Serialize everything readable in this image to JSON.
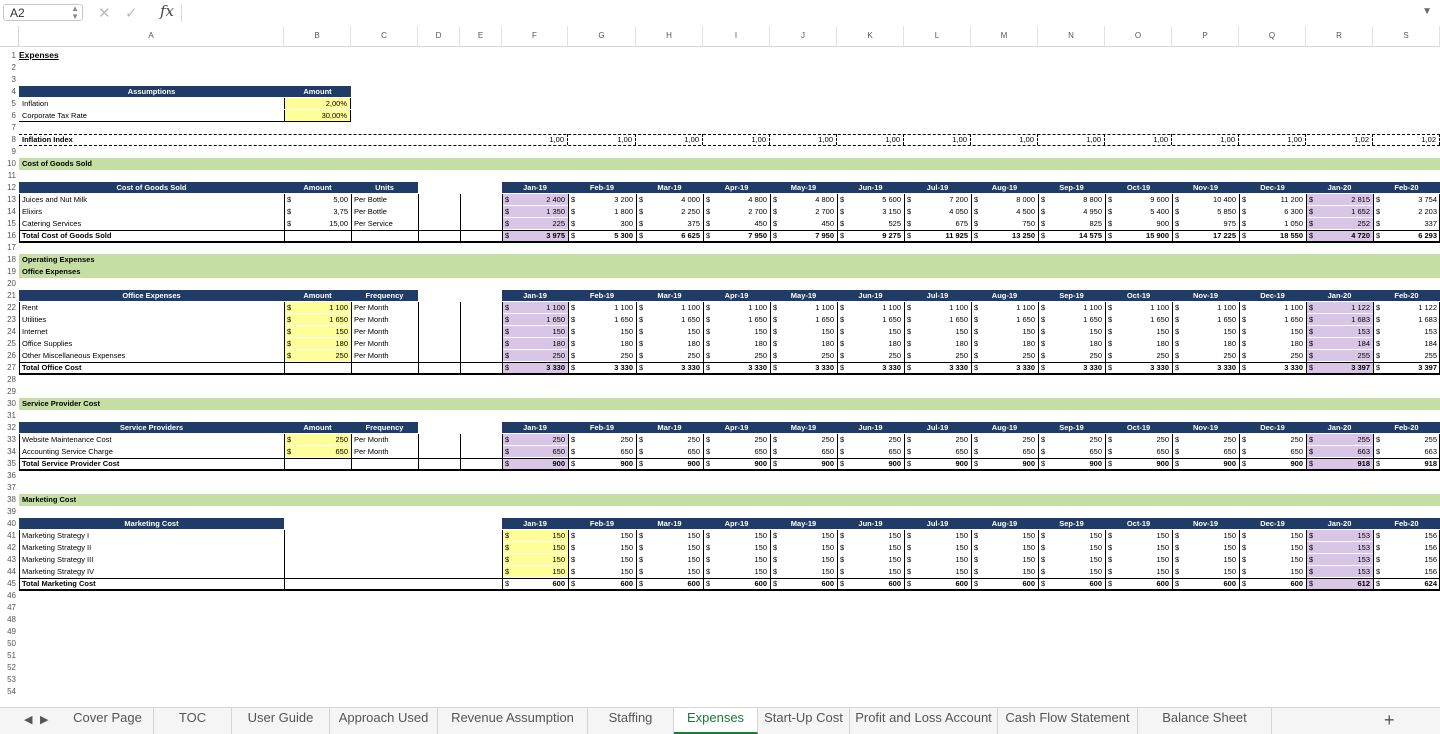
{
  "formula_bar": {
    "name_box": "A2",
    "fx": "fx",
    "cancel": "✕",
    "accept": "✓"
  },
  "columns": [
    "A",
    "B",
    "C",
    "D",
    "E",
    "F",
    "G",
    "H",
    "I",
    "J",
    "K",
    "L",
    "M",
    "N",
    "O",
    "P",
    "Q",
    "R",
    "S"
  ],
  "months": [
    "Jan-19",
    "Feb-19",
    "Mar-19",
    "Apr-19",
    "May-19",
    "Jun-19",
    "Jul-19",
    "Aug-19",
    "Sep-19",
    "Oct-19",
    "Nov-19",
    "Dec-19",
    "Jan-20",
    "Feb-20"
  ],
  "title": "Expenses",
  "assumptions": {
    "header": "Assumptions",
    "amount_header": "Amount",
    "rows": [
      {
        "label": "Inflation",
        "value": "2,00%"
      },
      {
        "label": "Corporate Tax Rate",
        "value": "30,00%"
      }
    ]
  },
  "inflation_index": {
    "label": "Inflation Index",
    "values": [
      "1,00",
      "1,00",
      "1,00",
      "1,00",
      "1,00",
      "1,00",
      "1,00",
      "1,00",
      "1,00",
      "1,00",
      "1,00",
      "1,00",
      "1,02",
      "1,02"
    ]
  },
  "sections": {
    "cogs_title": "Cost of Goods Sold",
    "opex_title": "Operating Expenses",
    "office_title": "Office Expenses",
    "service_title": "Service Provider Cost",
    "marketing_title": "Marketing Cost"
  },
  "currency": "$",
  "cogs": {
    "header": "Cost of Goods Sold",
    "amount_header": "Amount",
    "units_header": "Units",
    "rows": [
      {
        "label": "Juices and Nut Milk",
        "amount": "5,00",
        "unit": "Per Bottle",
        "values": [
          "2 400",
          "3 200",
          "4 000",
          "4 800",
          "4 800",
          "5 600",
          "7 200",
          "8 000",
          "8 800",
          "9 600",
          "10 400",
          "11 200",
          "2 815",
          "3 754"
        ]
      },
      {
        "label": "Elixirs",
        "amount": "3,75",
        "unit": "Per Bottle",
        "values": [
          "1 350",
          "1 800",
          "2 250",
          "2 700",
          "2 700",
          "3 150",
          "4 050",
          "4 500",
          "4 950",
          "5 400",
          "5 850",
          "6 300",
          "1 652",
          "2 203"
        ]
      },
      {
        "label": "Catering Services",
        "amount": "15,00",
        "unit": "Per Service",
        "values": [
          "225",
          "300",
          "375",
          "450",
          "450",
          "525",
          "675",
          "750",
          "825",
          "900",
          "975",
          "1 050",
          "252",
          "337"
        ]
      }
    ],
    "total": {
      "label": "Total Cost of Goods Sold",
      "values": [
        "3 975",
        "5 300",
        "6 625",
        "7 950",
        "7 950",
        "9 275",
        "11 925",
        "13 250",
        "14 575",
        "15 900",
        "17 225",
        "18 550",
        "4 720",
        "6 293"
      ]
    }
  },
  "office": {
    "header": "Office Expenses",
    "amount_header": "Amount",
    "freq_header": "Frequency",
    "rows": [
      {
        "label": "Rent",
        "amount": "1 100",
        "freq": "Per Month",
        "values": [
          "1 100",
          "1 100",
          "1 100",
          "1 100",
          "1 100",
          "1 100",
          "1 100",
          "1 100",
          "1 100",
          "1 100",
          "1 100",
          "1 100",
          "1 122",
          "1 122"
        ]
      },
      {
        "label": "Utilities",
        "amount": "1 650",
        "freq": "Per Month",
        "values": [
          "1 650",
          "1 650",
          "1 650",
          "1 650",
          "1 650",
          "1 650",
          "1 650",
          "1 650",
          "1 650",
          "1 650",
          "1 650",
          "1 650",
          "1 683",
          "1 683"
        ]
      },
      {
        "label": "Internet",
        "amount": "150",
        "freq": "Per Month",
        "values": [
          "150",
          "150",
          "150",
          "150",
          "150",
          "150",
          "150",
          "150",
          "150",
          "150",
          "150",
          "150",
          "153",
          "153"
        ]
      },
      {
        "label": "Office Supplies",
        "amount": "180",
        "freq": "Per Month",
        "values": [
          "180",
          "180",
          "180",
          "180",
          "180",
          "180",
          "180",
          "180",
          "180",
          "180",
          "180",
          "180",
          "184",
          "184"
        ]
      },
      {
        "label": "Other Miscellaneous Expenses",
        "amount": "250",
        "freq": "Per Month",
        "values": [
          "250",
          "250",
          "250",
          "250",
          "250",
          "250",
          "250",
          "250",
          "250",
          "250",
          "250",
          "250",
          "255",
          "255"
        ]
      }
    ],
    "total": {
      "label": "Total Office Cost",
      "values": [
        "3 330",
        "3 330",
        "3 330",
        "3 330",
        "3 330",
        "3 330",
        "3 330",
        "3 330",
        "3 330",
        "3 330",
        "3 330",
        "3 330",
        "3 397",
        "3 397"
      ]
    }
  },
  "service": {
    "header": "Service Providers",
    "amount_header": "Amount",
    "freq_header": "Frequency",
    "rows": [
      {
        "label": "Website Maintenance Cost",
        "amount": "250",
        "freq": "Per Month",
        "values": [
          "250",
          "250",
          "250",
          "250",
          "250",
          "250",
          "250",
          "250",
          "250",
          "250",
          "250",
          "250",
          "255",
          "255"
        ]
      },
      {
        "label": "Accounting Service Charge",
        "amount": "650",
        "freq": "Per Month",
        "values": [
          "650",
          "650",
          "650",
          "650",
          "650",
          "650",
          "650",
          "650",
          "650",
          "650",
          "650",
          "650",
          "663",
          "663"
        ]
      }
    ],
    "total": {
      "label": "Total Service Provider Cost",
      "values": [
        "900",
        "900",
        "900",
        "900",
        "900",
        "900",
        "900",
        "900",
        "900",
        "900",
        "900",
        "900",
        "918",
        "918"
      ]
    }
  },
  "marketing": {
    "header": "Marketing Cost",
    "rows": [
      {
        "label": "Marketing Strategy I",
        "values": [
          "150",
          "150",
          "150",
          "150",
          "150",
          "150",
          "150",
          "150",
          "150",
          "150",
          "150",
          "150",
          "153",
          "156"
        ]
      },
      {
        "label": "Marketing Strategy II",
        "values": [
          "150",
          "150",
          "150",
          "150",
          "150",
          "150",
          "150",
          "150",
          "150",
          "150",
          "150",
          "150",
          "153",
          "156"
        ]
      },
      {
        "label": "Marketing Strategy III",
        "values": [
          "150",
          "150",
          "150",
          "150",
          "150",
          "150",
          "150",
          "150",
          "150",
          "150",
          "150",
          "150",
          "153",
          "156"
        ]
      },
      {
        "label": "Marketing Strategy IV",
        "values": [
          "150",
          "150",
          "150",
          "150",
          "150",
          "150",
          "150",
          "150",
          "150",
          "150",
          "150",
          "150",
          "153",
          "156"
        ]
      }
    ],
    "total": {
      "label": "Total Marketing Cost",
      "values": [
        "600",
        "600",
        "600",
        "600",
        "600",
        "600",
        "600",
        "600",
        "600",
        "600",
        "600",
        "600",
        "612",
        "624"
      ]
    }
  },
  "tabs": [
    "Cover Page",
    "TOC",
    "User Guide",
    "Approach Used",
    "Revenue Assumption",
    "Staffing",
    "Expenses",
    "Start-Up Cost",
    "Profit and Loss Account",
    "Cash Flow Statement",
    "Balance Sheet"
  ],
  "active_tab": "Expenses",
  "add_sheet": "+",
  "colors": {
    "header_navy": "#1f3b66",
    "section_green": "#c4dea4",
    "input_yellow": "#ffff99",
    "highlight_purple": "#d9c6e6",
    "active_tab": "#1a7a3a"
  }
}
